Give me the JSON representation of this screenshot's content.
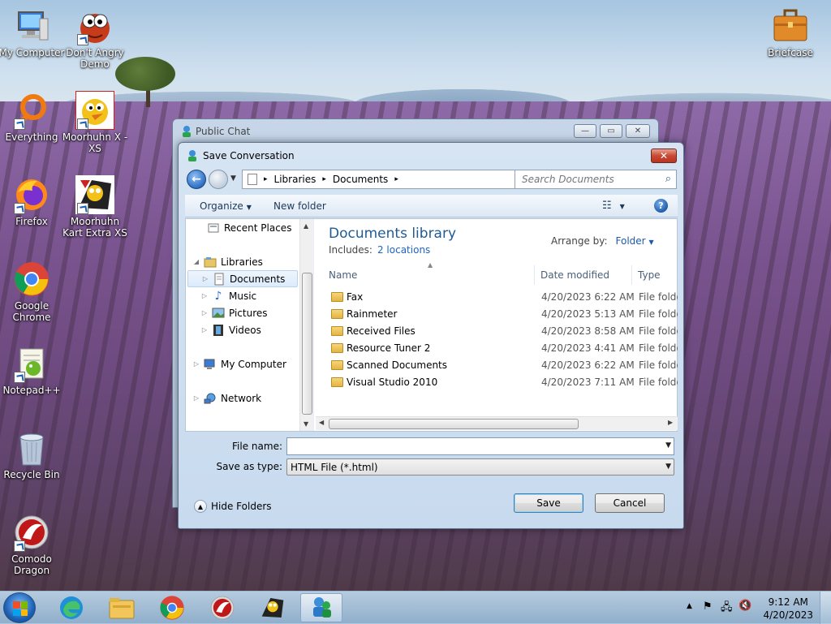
{
  "desktop": {
    "icons": [
      {
        "label": "My Computer"
      },
      {
        "label": "Don't Angry Demo"
      },
      {
        "label": "Everything"
      },
      {
        "label": "Moorhuhn X - XS"
      },
      {
        "label": "Firefox"
      },
      {
        "label": "Moorhuhn Kart Extra XS"
      },
      {
        "label": "Google Chrome"
      },
      {
        "label": "Notepad++"
      },
      {
        "label": "Recycle Bin"
      },
      {
        "label": "Comodo Dragon"
      },
      {
        "label": "Briefcase"
      }
    ]
  },
  "background_window": {
    "title": "Public Chat",
    "controls": {
      "minimize": "—",
      "maximize": "▭",
      "close": "✕"
    }
  },
  "dialog": {
    "title": "Save Conversation",
    "close_label": "✕",
    "address": {
      "crumbs": [
        "Libraries",
        "Documents"
      ],
      "separator": "▸"
    },
    "search": {
      "placeholder": "Search Documents"
    },
    "toolbar": {
      "organize": "Organize",
      "new_folder": "New folder",
      "help": "?"
    },
    "nav": {
      "items": [
        {
          "label": "Recent Places"
        },
        {
          "label": "Libraries"
        },
        {
          "label": "Documents"
        },
        {
          "label": "Music"
        },
        {
          "label": "Pictures"
        },
        {
          "label": "Videos"
        },
        {
          "label": "My Computer"
        },
        {
          "label": "Network"
        }
      ]
    },
    "content": {
      "title": "Documents library",
      "includes_label": "Includes:",
      "includes_link": "2 locations",
      "arrange_label": "Arrange by:",
      "arrange_value": "Folder",
      "columns": [
        "Name",
        "Date modified",
        "Type"
      ],
      "rows": [
        {
          "name": "Fax",
          "date": "4/20/2023 6:22 AM",
          "type": "File folder"
        },
        {
          "name": "Rainmeter",
          "date": "4/20/2023 5:13 AM",
          "type": "File folder"
        },
        {
          "name": "Received Files",
          "date": "4/20/2023 8:58 AM",
          "type": "File folder"
        },
        {
          "name": "Resource Tuner 2",
          "date": "4/20/2023 4:41 AM",
          "type": "File folder"
        },
        {
          "name": "Scanned Documents",
          "date": "4/20/2023 6:22 AM",
          "type": "File folder"
        },
        {
          "name": "Visual Studio 2010",
          "date": "4/20/2023 7:11 AM",
          "type": "File folder"
        }
      ]
    },
    "file_name_label": "File name:",
    "file_name_value": "",
    "save_type_label": "Save as type:",
    "save_type_value": "HTML File (*.html)",
    "hide_folders": "Hide Folders",
    "save_button": "Save",
    "cancel_button": "Cancel"
  },
  "taskbar": {
    "clock_time": "9:12 AM",
    "clock_date": "4/20/2023"
  }
}
